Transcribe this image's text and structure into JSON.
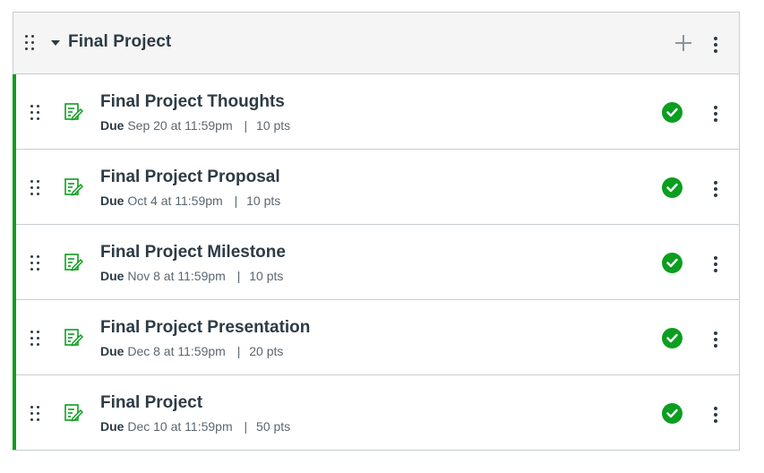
{
  "module": {
    "title": "Final Project",
    "icons": {
      "drag": "drag-handle-icon",
      "collapse": "caret-down-icon",
      "add": "plus-icon",
      "menu": "kebab-menu-icon"
    }
  },
  "items": [
    {
      "title": "Final Project Thoughts",
      "due_label": "Due",
      "due_date": "Sep 20 at 11:59pm",
      "points": "10 pts"
    },
    {
      "title": "Final Project Proposal",
      "due_label": "Due",
      "due_date": "Oct 4 at 11:59pm",
      "points": "10 pts"
    },
    {
      "title": "Final Project Milestone",
      "due_label": "Due",
      "due_date": "Nov 8 at 11:59pm",
      "points": "10 pts"
    },
    {
      "title": "Final Project Presentation",
      "due_label": "Due",
      "due_date": "Dec 8 at 11:59pm",
      "points": "20 pts"
    },
    {
      "title": "Final Project",
      "due_label": "Due",
      "due_date": "Dec 10 at 11:59pm",
      "points": "50 pts"
    }
  ],
  "separator": "|",
  "colors": {
    "published_green": "#0b9e1f",
    "text": "#2d3b45",
    "header_bg": "#f5f5f5",
    "border": "#c7cdd1"
  },
  "item_icons": {
    "type": "assignment-icon",
    "status": "published-check-icon"
  }
}
